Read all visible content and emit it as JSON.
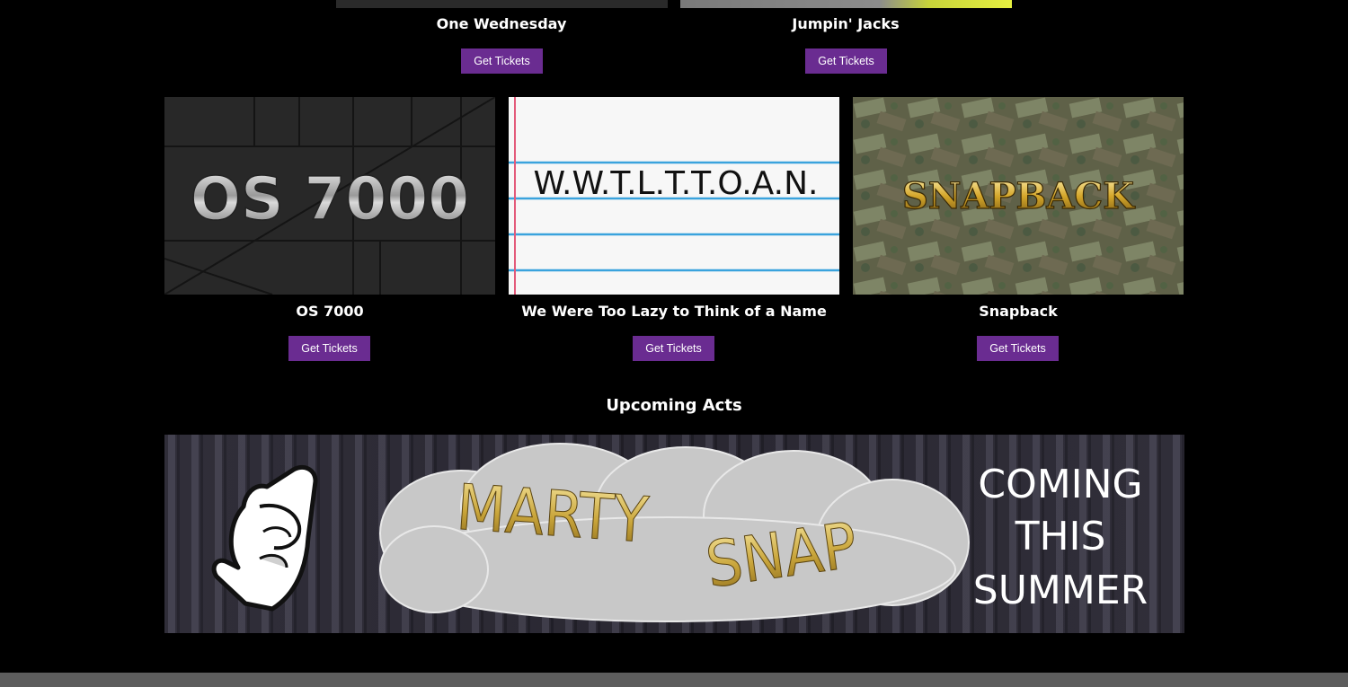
{
  "shows_row1": [
    {
      "title": "One Wednesday",
      "button": "Get Tickets"
    },
    {
      "title": "Jumpin' Jacks",
      "button": "Get Tickets"
    }
  ],
  "shows_row2": [
    {
      "title": "OS 7000",
      "button": "Get Tickets",
      "art_text": "OS 7000"
    },
    {
      "title": "We Were Too Lazy to Think of a Name",
      "button": "Get Tickets",
      "art_text": "W.W.T.L.T.T.O.A.N."
    },
    {
      "title": "Snapback",
      "button": "Get Tickets",
      "art_text": "SNAPBACK"
    }
  ],
  "upcoming": {
    "heading": "Upcoming Acts",
    "banner": {
      "line1": "MARTY",
      "line2": "SNAP",
      "coming": [
        "COMING",
        "THIS",
        "SUMMER"
      ]
    }
  },
  "colors": {
    "button": "#6a2c91",
    "background": "#000000",
    "footer": "#5d5d5d"
  }
}
